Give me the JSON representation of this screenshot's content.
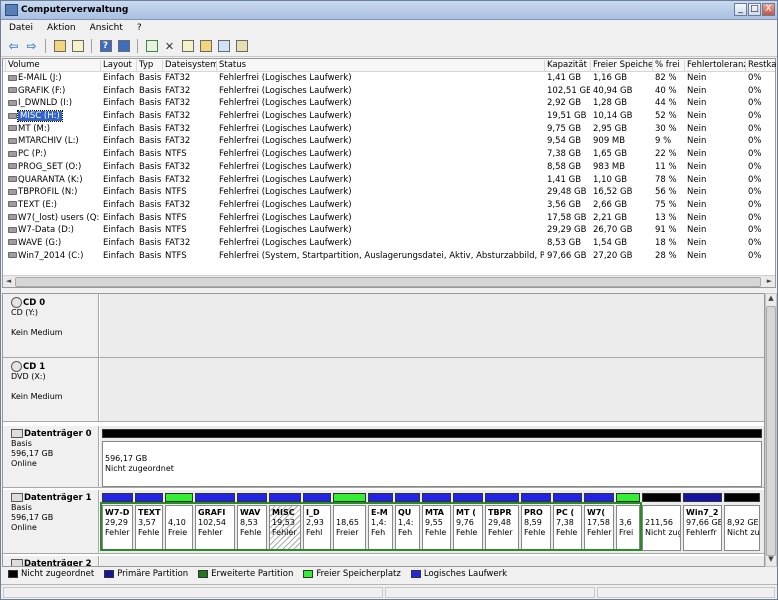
{
  "window": {
    "title": "Computerverwaltung",
    "btn_min": "_",
    "btn_max": "□",
    "btn_close": "X"
  },
  "menu": [
    "Datei",
    "Aktion",
    "Ansicht",
    "?"
  ],
  "toolbar": {
    "back": "⇦",
    "forward": "⇨",
    "icons": [
      "folder-up-icon",
      "show-tree-icon",
      "help-icon",
      "properties-icon",
      "refresh-icon",
      "delete-icon",
      "export-icon",
      "open-icon",
      "search-icon",
      "settings-icon"
    ]
  },
  "volume_list": {
    "columns": [
      "Volume",
      "Layout",
      "Typ",
      "Dateisystem",
      "Status",
      "Kapazität",
      "Freier Speicher",
      "% frei",
      "Fehlertoleranz",
      "Restkap"
    ],
    "rows": [
      [
        "E-MAIL (J:)",
        "Einfach",
        "Basis",
        "FAT32",
        "Fehlerfrei (Logisches Laufwerk)",
        "1,41 GB",
        "1,16 GB",
        "82 %",
        "Nein",
        "0%"
      ],
      [
        "GRAFIK (F:)",
        "Einfach",
        "Basis",
        "FAT32",
        "Fehlerfrei (Logisches Laufwerk)",
        "102,51 GB",
        "40,94 GB",
        "40 %",
        "Nein",
        "0%"
      ],
      [
        "I_DWNLD (I:)",
        "Einfach",
        "Basis",
        "FAT32",
        "Fehlerfrei (Logisches Laufwerk)",
        "2,92 GB",
        "1,28 GB",
        "44 %",
        "Nein",
        "0%"
      ],
      [
        "MISC (H:)",
        "Einfach",
        "Basis",
        "FAT32",
        "Fehlerfrei (Logisches Laufwerk)",
        "19,51 GB",
        "10,14 GB",
        "52 %",
        "Nein",
        "0%"
      ],
      [
        "MT (M:)",
        "Einfach",
        "Basis",
        "FAT32",
        "Fehlerfrei (Logisches Laufwerk)",
        "9,75 GB",
        "2,95 GB",
        "30 %",
        "Nein",
        "0%"
      ],
      [
        "MTARCHIV (L:)",
        "Einfach",
        "Basis",
        "FAT32",
        "Fehlerfrei (Logisches Laufwerk)",
        "9,54 GB",
        "909 MB",
        "9 %",
        "Nein",
        "0%"
      ],
      [
        "PC (P:)",
        "Einfach",
        "Basis",
        "NTFS",
        "Fehlerfrei (Logisches Laufwerk)",
        "7,38 GB",
        "1,65 GB",
        "22 %",
        "Nein",
        "0%"
      ],
      [
        "PROG_SET (O:)",
        "Einfach",
        "Basis",
        "FAT32",
        "Fehlerfrei (Logisches Laufwerk)",
        "8,58 GB",
        "983 MB",
        "11 %",
        "Nein",
        "0%"
      ],
      [
        "QUARANTA (K:)",
        "Einfach",
        "Basis",
        "FAT32",
        "Fehlerfrei (Logisches Laufwerk)",
        "1,41 GB",
        "1,10 GB",
        "78 %",
        "Nein",
        "0%"
      ],
      [
        "TBPROFIL (N:)",
        "Einfach",
        "Basis",
        "NTFS",
        "Fehlerfrei (Logisches Laufwerk)",
        "29,48 GB",
        "16,52 GB",
        "56 %",
        "Nein",
        "0%"
      ],
      [
        "TEXT (E:)",
        "Einfach",
        "Basis",
        "FAT32",
        "Fehlerfrei (Logisches Laufwerk)",
        "3,56 GB",
        "2,66 GB",
        "75 %",
        "Nein",
        "0%"
      ],
      [
        "W7(_lost) users (Q:)",
        "Einfach",
        "Basis",
        "NTFS",
        "Fehlerfrei (Logisches Laufwerk)",
        "17,58 GB",
        "2,21 GB",
        "13 %",
        "Nein",
        "0%"
      ],
      [
        "W7-Data (D:)",
        "Einfach",
        "Basis",
        "NTFS",
        "Fehlerfrei (Logisches Laufwerk)",
        "29,29 GB",
        "26,70 GB",
        "91 %",
        "Nein",
        "0%"
      ],
      [
        "WAVE (G:)",
        "Einfach",
        "Basis",
        "FAT32",
        "Fehlerfrei (Logisches Laufwerk)",
        "8,53 GB",
        "1,54 GB",
        "18 %",
        "Nein",
        "0%"
      ],
      [
        "Win7_2014 (C:)",
        "Einfach",
        "Basis",
        "NTFS",
        "Fehlerfrei (System, Startpartition, Auslagerungsdatei, Aktiv, Absturzabbild, Primäre P…",
        "97,66 GB",
        "27,20 GB",
        "28 %",
        "Nein",
        "0%"
      ]
    ],
    "selected_index": 3
  },
  "disks": [
    {
      "name": "CD 0",
      "sub": "CD (Y:)",
      "state": "Kein Medium"
    },
    {
      "name": "CD 1",
      "sub": "DVD (X:)",
      "state": "Kein Medium"
    },
    {
      "name": "Datenträger 0",
      "type": "Basis",
      "size": "596,17 GB",
      "state": "Online",
      "unalloc_size": "596,17 GB",
      "unalloc_label": "Nicht zugeordnet"
    },
    {
      "name": "Datenträger 1",
      "type": "Basis",
      "size": "596,17 GB",
      "state": "Online",
      "partitions": [
        {
          "name": "W7-D",
          "size": "29,29",
          "status": "Fehler",
          "kind": "logical"
        },
        {
          "name": "TEXT",
          "size": "3,57",
          "status": "Fehle",
          "kind": "logical"
        },
        {
          "name": "",
          "size": "4,10",
          "status": "Freie",
          "kind": "free"
        },
        {
          "name": "GRAFI",
          "size": "102,54",
          "status": "Fehler",
          "kind": "logical"
        },
        {
          "name": "WAV",
          "size": "8,53",
          "status": "Fehle",
          "kind": "logical"
        },
        {
          "name": "MISC",
          "size": "19,53",
          "status": "Fehler",
          "kind": "selected"
        },
        {
          "name": "I_D",
          "size": "2,93",
          "status": "Fehl",
          "kind": "logical"
        },
        {
          "name": "",
          "size": "18,65",
          "status": "Freier",
          "kind": "free"
        },
        {
          "name": "E-M",
          "size": "1,4:",
          "status": "Feh",
          "kind": "logical"
        },
        {
          "name": "QU",
          "size": "1,4:",
          "status": "Feh",
          "kind": "logical"
        },
        {
          "name": "MTA",
          "size": "9,55",
          "status": "Fehle",
          "kind": "logical"
        },
        {
          "name": "MT (",
          "size": "9,76",
          "status": "Fehle",
          "kind": "logical"
        },
        {
          "name": "TBPR",
          "size": "29,48",
          "status": "Fehler",
          "kind": "logical"
        },
        {
          "name": "PRO",
          "size": "8,59",
          "status": "Fehle",
          "kind": "logical"
        },
        {
          "name": "PC (",
          "size": "7,38",
          "status": "Fehle",
          "kind": "logical"
        },
        {
          "name": "W7(",
          "size": "17,58",
          "status": "Fehler",
          "kind": "logical"
        },
        {
          "name": "",
          "size": "3,6",
          "status": "Frei",
          "kind": "free"
        },
        {
          "name": "",
          "size": "211,56",
          "status": "Nicht zug",
          "kind": "unallocated"
        },
        {
          "name": "Win7_2",
          "size": "97,66 GB",
          "status": "Fehlerfr",
          "kind": "primary"
        },
        {
          "name": "",
          "size": "8,92 GE",
          "status": "Nicht zu",
          "kind": "unallocated"
        }
      ]
    },
    {
      "name": "Datenträger 2"
    }
  ],
  "legend": [
    {
      "label": "Nicht zugeordnet",
      "color": "#000000"
    },
    {
      "label": "Primäre Partition",
      "color": "#1414a0"
    },
    {
      "label": "Erweiterte Partition",
      "color": "#1f7a1f"
    },
    {
      "label": "Freier Speicherplatz",
      "color": "#33ee33"
    },
    {
      "label": "Logisches Laufwerk",
      "color": "#2323e6"
    }
  ]
}
